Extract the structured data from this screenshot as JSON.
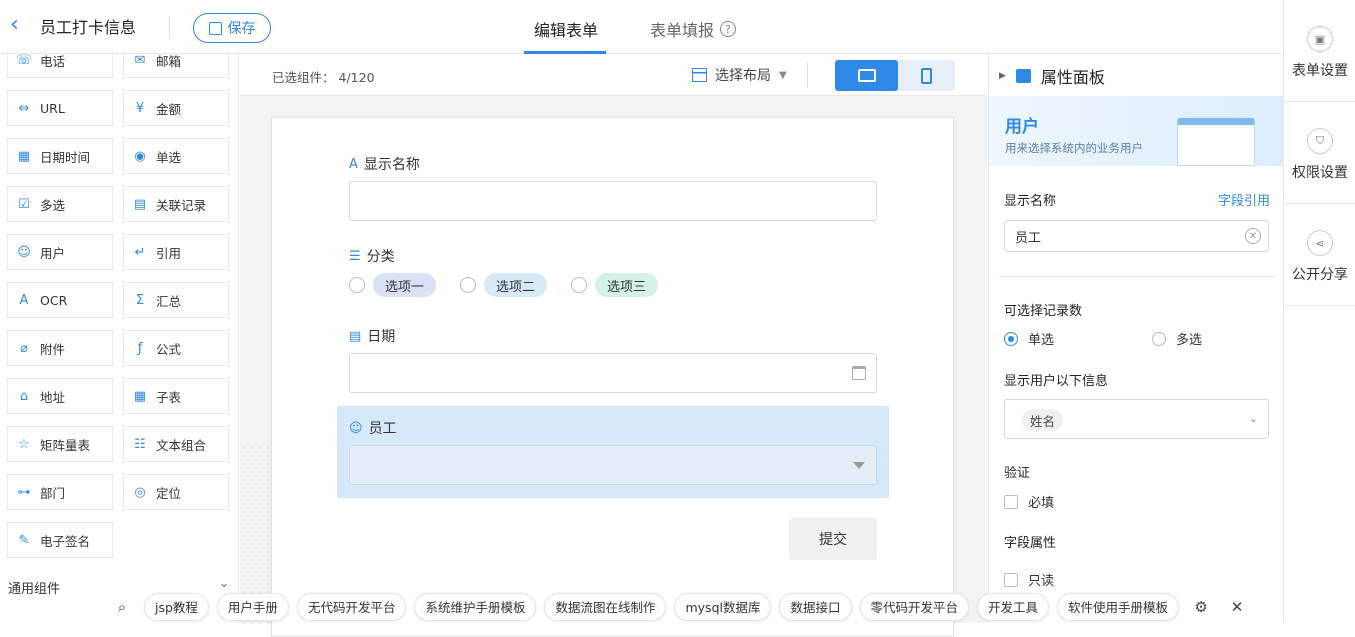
{
  "header": {
    "title": "员工打卡信息",
    "save_label": "保存",
    "tab_edit": "编辑表单",
    "tab_fill": "表单填报",
    "help_icon": "?"
  },
  "right_rail": {
    "items": [
      {
        "label": "表单设置",
        "icon": "form-settings-icon"
      },
      {
        "label": "权限设置",
        "icon": "shield-icon"
      },
      {
        "label": "公开分享",
        "icon": "share-icon"
      }
    ]
  },
  "left_panel": {
    "components": [
      {
        "label": "电话",
        "icon": "phone-icon",
        "glyph": "☏"
      },
      {
        "label": "邮箱",
        "icon": "mail-icon",
        "glyph": "✉"
      },
      {
        "label": "URL",
        "icon": "link-icon",
        "glyph": "⇔"
      },
      {
        "label": "金额",
        "icon": "currency-icon",
        "glyph": "¥"
      },
      {
        "label": "日期时间",
        "icon": "calendar-icon",
        "glyph": "▦"
      },
      {
        "label": "单选",
        "icon": "radio-icon",
        "glyph": "◉"
      },
      {
        "label": "多选",
        "icon": "checkbox-icon",
        "glyph": "☑"
      },
      {
        "label": "关联记录",
        "icon": "relation-icon",
        "glyph": "▤"
      },
      {
        "label": "用户",
        "icon": "user-icon",
        "glyph": "☺"
      },
      {
        "label": "引用",
        "icon": "quote-icon",
        "glyph": "↵"
      },
      {
        "label": "OCR",
        "icon": "ocr-icon",
        "glyph": "A"
      },
      {
        "label": "汇总",
        "icon": "sum-icon",
        "glyph": "Σ"
      },
      {
        "label": "附件",
        "icon": "attachment-icon",
        "glyph": "⌀"
      },
      {
        "label": "公式",
        "icon": "formula-icon",
        "glyph": "ƒ"
      },
      {
        "label": "地址",
        "icon": "address-icon",
        "glyph": "⌂"
      },
      {
        "label": "子表",
        "icon": "subtable-icon",
        "glyph": "▦"
      },
      {
        "label": "矩阵量表",
        "icon": "matrix-icon",
        "glyph": "☆"
      },
      {
        "label": "文本组合",
        "icon": "text-combo-icon",
        "glyph": "☷"
      },
      {
        "label": "部门",
        "icon": "department-icon",
        "glyph": "⊶"
      },
      {
        "label": "定位",
        "icon": "location-icon",
        "glyph": "◎"
      },
      {
        "label": "电子签名",
        "icon": "signature-icon",
        "glyph": "✎"
      }
    ],
    "section_label": "通用组件"
  },
  "canvas": {
    "selected_label": "已选组件：",
    "selected_value": "4/120",
    "layout_label": "选择布局",
    "fields": {
      "name_label": "显示名称",
      "category_label": "分类",
      "options": [
        "选项一",
        "选项二",
        "选项三"
      ],
      "date_label": "日期",
      "employee_label": "员工"
    },
    "submit_label": "提交"
  },
  "property_panel": {
    "title": "属性面板",
    "banner_title": "用户",
    "banner_subtitle": "用来选择系统内的业务用户",
    "display_name_label": "显示名称",
    "field_ref_link": "字段引用",
    "display_name_value": "员工",
    "selectable_label": "可选择记录数",
    "single_label": "单选",
    "multi_label": "多选",
    "show_info_label": "显示用户以下信息",
    "show_info_tag": "姓名",
    "validation_label": "验证",
    "required_label": "必填",
    "field_attr_label": "字段属性",
    "readonly_label": "只读"
  },
  "bottom_bar": {
    "chips": [
      "jsp教程",
      "用户手册",
      "无代码开发平台",
      "系统维护手册模板",
      "数据流图在线制作",
      "mysql数据库",
      "数据接口",
      "零代码开发平台",
      "开发工具",
      "软件使用手册模板"
    ]
  },
  "colors": {
    "accent": "#2e8ae6",
    "option1": "#d9e1f7",
    "option2": "#d6eaf8",
    "option3": "#d4f2e6",
    "selected_field": "#d6e9fb"
  }
}
